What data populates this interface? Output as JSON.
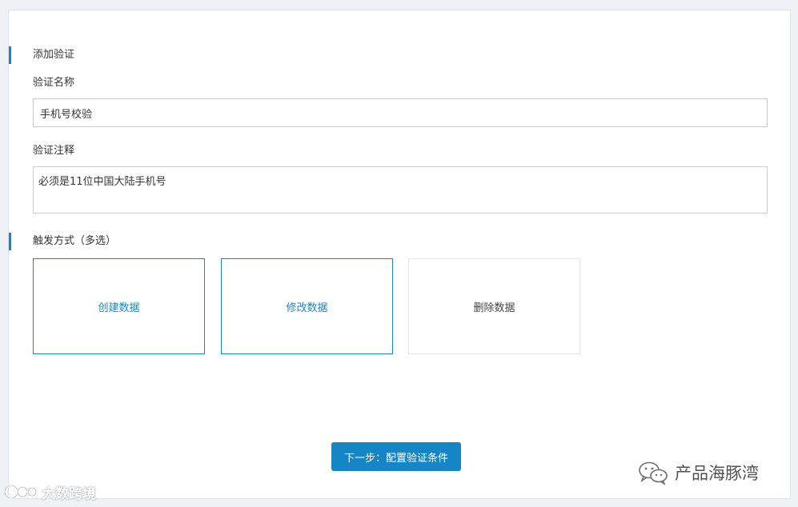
{
  "form": {
    "section_add": "添加验证",
    "name_label": "验证名称",
    "name_value": "手机号校验",
    "note_label": "验证注释",
    "note_value": "必须是11位中国大陆手机号",
    "trigger_title": "触发方式（多选）",
    "triggers": [
      {
        "label": "创建数据",
        "selected": true
      },
      {
        "label": "修改数据",
        "selected": true
      },
      {
        "label": "删除数据",
        "selected": false
      }
    ],
    "next_button": "下一步：配置验证条件"
  },
  "colors": {
    "accent": "#1486c6",
    "border": "#c9ccd1",
    "background": "#eef1f5"
  },
  "watermarks": {
    "right_text": "产品海豚湾",
    "right_icon": "wechat-icon",
    "left_text": "大数跨境",
    "left_icon": "brand-logo-icon"
  }
}
